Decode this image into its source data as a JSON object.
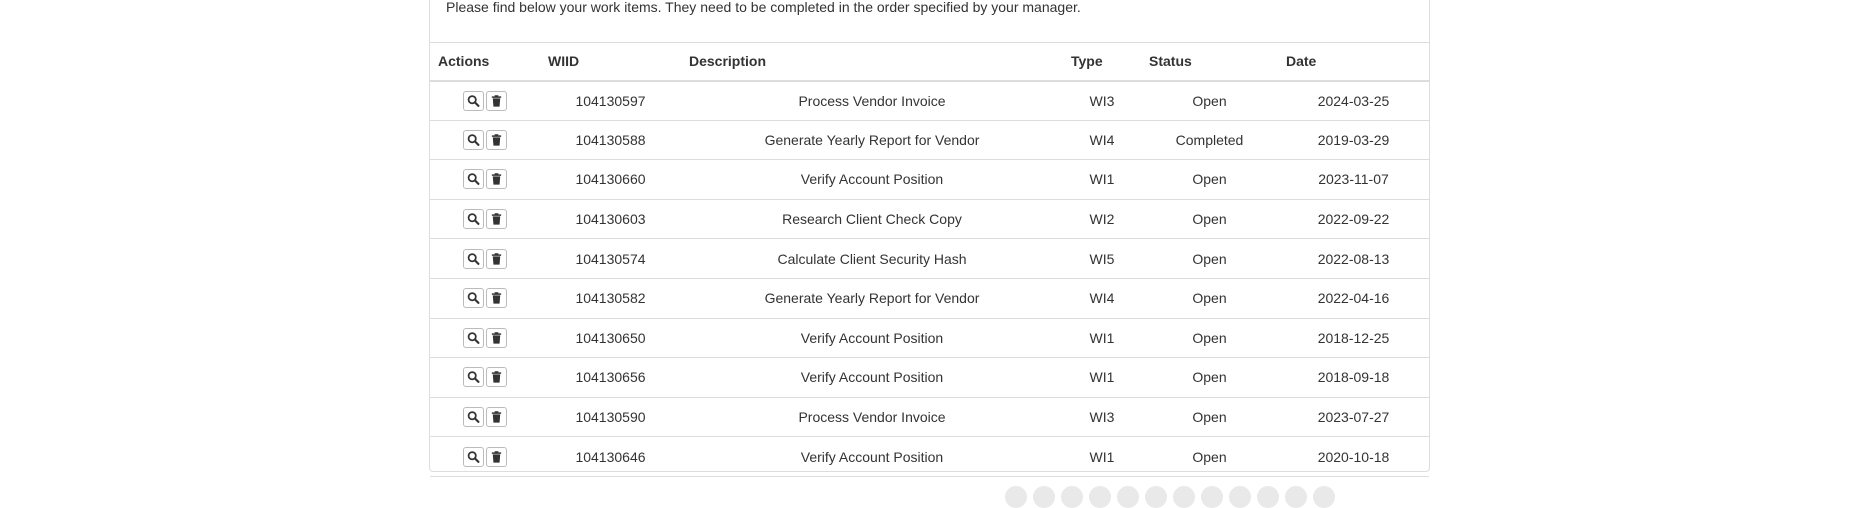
{
  "intro_text": "Please find below your work items. They need to be completed in the order specified by your manager.",
  "table": {
    "headers": {
      "actions": "Actions",
      "wiid": "WIID",
      "description": "Description",
      "type": "Type",
      "status": "Status",
      "date": "Date"
    },
    "rows": [
      {
        "wiid": "104130597",
        "description": "Process Vendor Invoice",
        "type": "WI3",
        "status": "Open",
        "date": "2024-03-25"
      },
      {
        "wiid": "104130588",
        "description": "Generate Yearly Report for Vendor",
        "type": "WI4",
        "status": "Completed",
        "date": "2019-03-29"
      },
      {
        "wiid": "104130660",
        "description": "Verify Account Position",
        "type": "WI1",
        "status": "Open",
        "date": "2023-11-07"
      },
      {
        "wiid": "104130603",
        "description": "Research Client Check Copy",
        "type": "WI2",
        "status": "Open",
        "date": "2022-09-22"
      },
      {
        "wiid": "104130574",
        "description": "Calculate Client Security Hash",
        "type": "WI5",
        "status": "Open",
        "date": "2022-08-13"
      },
      {
        "wiid": "104130582",
        "description": "Generate Yearly Report for Vendor",
        "type": "WI4",
        "status": "Open",
        "date": "2022-04-16"
      },
      {
        "wiid": "104130650",
        "description": "Verify Account Position",
        "type": "WI1",
        "status": "Open",
        "date": "2018-12-25"
      },
      {
        "wiid": "104130656",
        "description": "Verify Account Position",
        "type": "WI1",
        "status": "Open",
        "date": "2018-09-18"
      },
      {
        "wiid": "104130590",
        "description": "Process Vendor Invoice",
        "type": "WI3",
        "status": "Open",
        "date": "2023-07-27"
      },
      {
        "wiid": "104130646",
        "description": "Verify Account Position",
        "type": "WI1",
        "status": "Open",
        "date": "2020-10-18"
      }
    ]
  },
  "icons": {
    "view": "search-icon",
    "delete": "trash-icon"
  }
}
